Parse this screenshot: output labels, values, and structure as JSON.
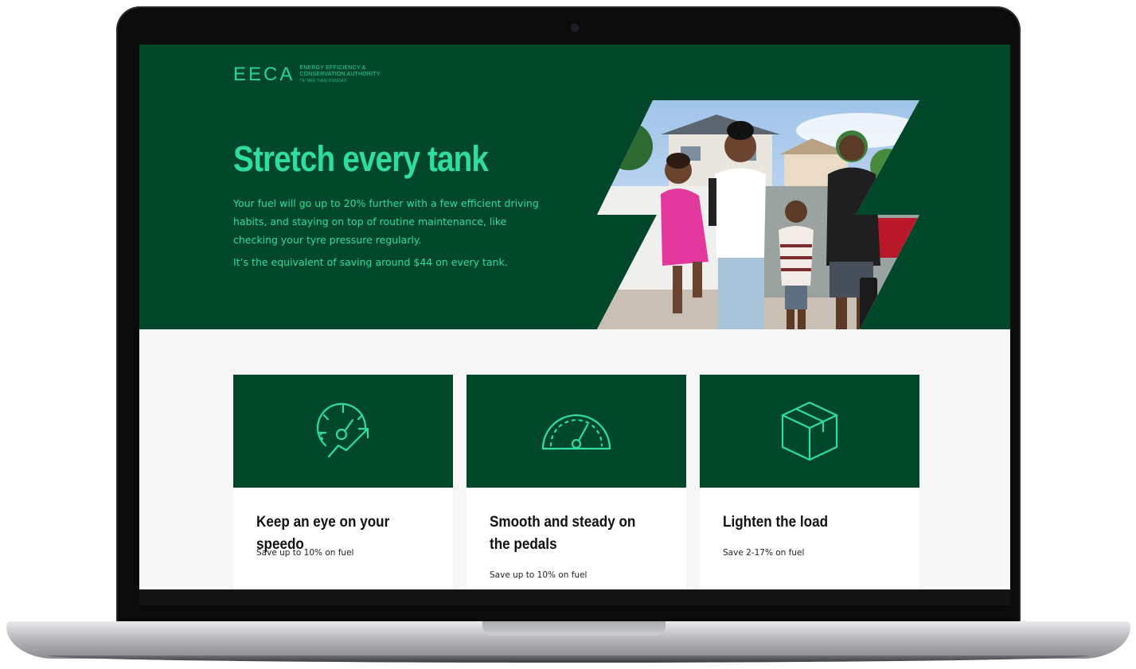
{
  "brand": {
    "logo_mark": "EECA",
    "logo_line1": "ENERGY EFFICIENCY &",
    "logo_line2": "CONSERVATION AUTHORITY",
    "logo_line3": "TE TARI TIAKI PŪNGAO",
    "accent_color": "#2fdca2",
    "dark_green": "#01472a"
  },
  "hero": {
    "title": "Stretch every tank",
    "paragraph1": "Your fuel will go up to 20% further with a few efficient driving habits, and staying on top of routine maintenance, like checking your tyre pressure regularly.",
    "paragraph2": "It’s the equivalent of saving around $44 on every tank."
  },
  "cards": [
    {
      "icon": "speedometer-arrow-icon",
      "title": "Keep an eye on your speedo",
      "subtitle": "Save up to 10% on fuel"
    },
    {
      "icon": "gauge-icon",
      "title": "Smooth and steady on the pedals",
      "subtitle": "Save up to 10% on fuel"
    },
    {
      "icon": "box-icon",
      "title": "Lighten the load",
      "subtitle": "Save 2-17% on fuel"
    }
  ]
}
